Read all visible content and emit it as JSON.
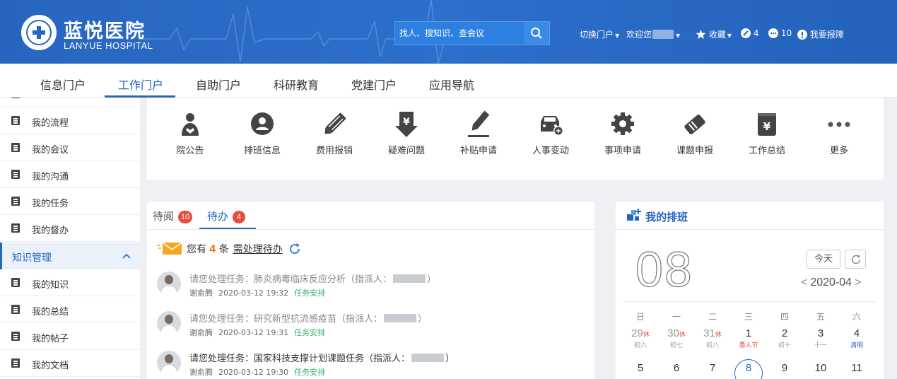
{
  "header": {
    "logo_cn": "蓝悦医院",
    "logo_en": "LANYUE HOSPITAL",
    "search_placeholder": "找人、搜知识、查会议",
    "switch_portal": "切换门户",
    "welcome": "欢迎您",
    "favorites": "收藏",
    "edit_count": "4",
    "message_count": "10",
    "report": "我要报障"
  },
  "tabs": [
    "信息门户",
    "工作门户",
    "自助门户",
    "科研教育",
    "党建门户",
    "应用导航"
  ],
  "sidebar": {
    "items_top": [
      "我的流程",
      "我的会议",
      "我的沟通",
      "我的任务",
      "我的督办"
    ],
    "group": "知识管理",
    "items_bottom": [
      "我的知识",
      "我的总结",
      "我的帖子",
      "我的文档"
    ]
  },
  "apps": [
    {
      "label": "院公告",
      "icon": "megaphone-icon"
    },
    {
      "label": "排班信息",
      "icon": "person-icon"
    },
    {
      "label": "费用报销",
      "icon": "pencil-icon"
    },
    {
      "label": "疑难问题",
      "icon": "yen-download-icon"
    },
    {
      "label": "补贴申请",
      "icon": "edit-icon"
    },
    {
      "label": "人事变动",
      "icon": "car-icon"
    },
    {
      "label": "事项申请",
      "icon": "gear-icon"
    },
    {
      "label": "课题申报",
      "icon": "tag-icon"
    },
    {
      "label": "工作总结",
      "icon": "yen-doc-icon"
    },
    {
      "label": "更多",
      "icon": "more-icon"
    }
  ],
  "todo": {
    "tab_read": "待阅",
    "tab_read_badge": "10",
    "tab_todo": "待办",
    "tab_todo_badge": "4",
    "notice_prefix": "您有",
    "notice_count": "4",
    "notice_unit": "条",
    "notice_link": "需处理待办",
    "tasks": [
      {
        "title": "请您处理任务：肺炎病毒临床反应分析（指派人：",
        "close": "）",
        "user": "谢俞腾",
        "date": "2020-03-12 19:32",
        "tag": "任务安排"
      },
      {
        "title": "请您处理任务：研究新型抗流感疫苗（指派人：",
        "close": "）",
        "user": "谢俞腾",
        "date": "2020-03-12 19:31",
        "tag": "任务安排"
      },
      {
        "title": "请您处理任务：国家科技支撑计划课题任务（指派人：",
        "close": "）",
        "user": "谢俞腾",
        "date": "2020-03-12 19:30",
        "tag": "任务安排"
      }
    ]
  },
  "schedule": {
    "title": "我的排班",
    "big_day": "08",
    "today_btn": "今天",
    "prev": "<",
    "month": "2020-04",
    "next": ">",
    "weekdays": [
      "日",
      "一",
      "二",
      "三",
      "四",
      "五",
      "六"
    ],
    "week1": [
      {
        "n": "29",
        "sup": "休",
        "sub": "初六",
        "prev": true
      },
      {
        "n": "30",
        "sup": "休",
        "sub": "初七",
        "prev": true
      },
      {
        "n": "31",
        "sup": "休",
        "sub": "初八",
        "prev": true
      },
      {
        "n": "1",
        "sub": "愚人节",
        "subClass": "red"
      },
      {
        "n": "2",
        "sub": "初十"
      },
      {
        "n": "3",
        "sub": "十一"
      },
      {
        "n": "4",
        "sub": "清明",
        "subClass": "blue"
      }
    ],
    "week2": [
      {
        "n": "5"
      },
      {
        "n": "6"
      },
      {
        "n": "7"
      },
      {
        "n": "8",
        "cur": true
      },
      {
        "n": "9"
      },
      {
        "n": "10"
      },
      {
        "n": "11"
      }
    ]
  },
  "colors": {
    "brand": "#2766c0",
    "badge": "#e74c3c",
    "tag": "#2fb574"
  }
}
